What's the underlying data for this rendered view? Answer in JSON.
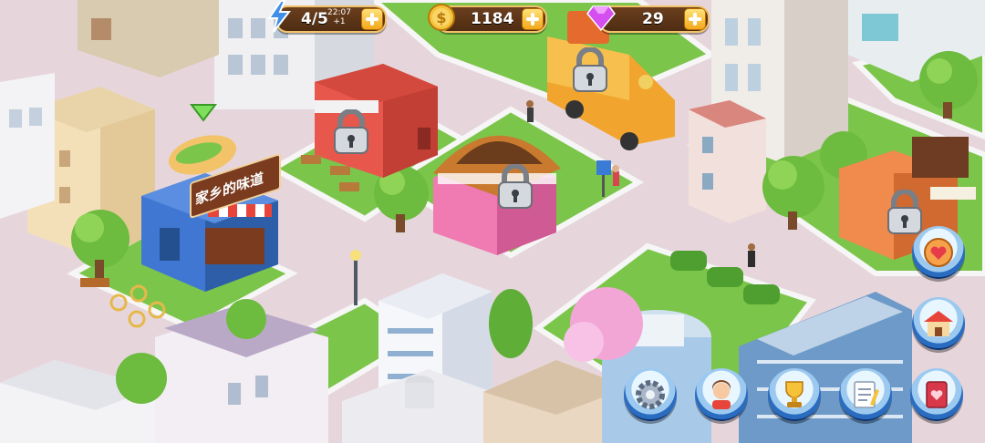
{
  "hud": {
    "energy": {
      "value": "4/5",
      "timer": "22:07",
      "timer_delta": "+1",
      "icon": "lightning-icon"
    },
    "coins": {
      "value": "1184",
      "icon": "coin-icon"
    },
    "gems": {
      "value": "29",
      "icon": "gem-icon"
    }
  },
  "buildings": {
    "restaurant_sign": "家乡的味道"
  },
  "menu": {
    "icons": [
      "settings-icon",
      "friends-icon",
      "trophy-icon",
      "notepad-icon",
      "book-icon",
      "shop-icon",
      "compass-heart-icon"
    ]
  },
  "colors": {
    "accent_gold": "#f2c26a",
    "pill_brown": "#5a3417",
    "button_blue": "#2a6cc0",
    "grass": "#7cc54b",
    "road": "#e7d7dc"
  }
}
